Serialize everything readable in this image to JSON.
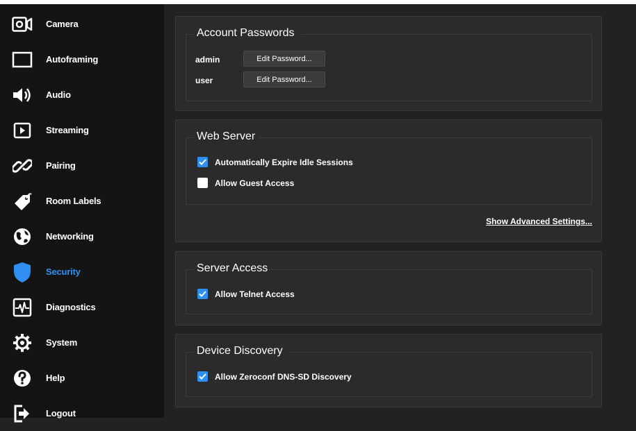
{
  "sidebar": {
    "items": [
      {
        "label": "Camera",
        "icon": "camera-icon"
      },
      {
        "label": "Autoframing",
        "icon": "frame-icon"
      },
      {
        "label": "Audio",
        "icon": "speaker-icon"
      },
      {
        "label": "Streaming",
        "icon": "play-icon"
      },
      {
        "label": "Pairing",
        "icon": "link-icon"
      },
      {
        "label": "Room Labels",
        "icon": "tag-icon"
      },
      {
        "label": "Networking",
        "icon": "globe-icon"
      },
      {
        "label": "Security",
        "icon": "shield-icon",
        "active": true
      },
      {
        "label": "Diagnostics",
        "icon": "pulse-icon"
      },
      {
        "label": "System",
        "icon": "gear-icon"
      },
      {
        "label": "Help",
        "icon": "help-icon"
      },
      {
        "label": "Logout",
        "icon": "logout-icon"
      }
    ],
    "active_color": "#2f8ff0"
  },
  "account": {
    "title": "Account Passwords",
    "rows": [
      {
        "user": "admin",
        "button": "Edit Password..."
      },
      {
        "user": "user",
        "button": "Edit Password..."
      }
    ]
  },
  "webserver": {
    "title": "Web Server",
    "expire_label": "Automatically Expire Idle Sessions",
    "expire_checked": true,
    "guest_label": "Allow Guest Access",
    "guest_checked": false,
    "advanced_link": "Show Advanced Settings..."
  },
  "server_access": {
    "title": "Server Access",
    "telnet_label": "Allow Telnet Access",
    "telnet_checked": true
  },
  "discovery": {
    "title": "Device Discovery",
    "zeroconf_label": "Allow Zeroconf DNS-SD Discovery",
    "zeroconf_checked": true
  },
  "colors": {
    "accent": "#2f8ff0",
    "sidebar_bg": "#141414",
    "main_bg": "#222222",
    "card_bg": "#2b2b2b"
  }
}
